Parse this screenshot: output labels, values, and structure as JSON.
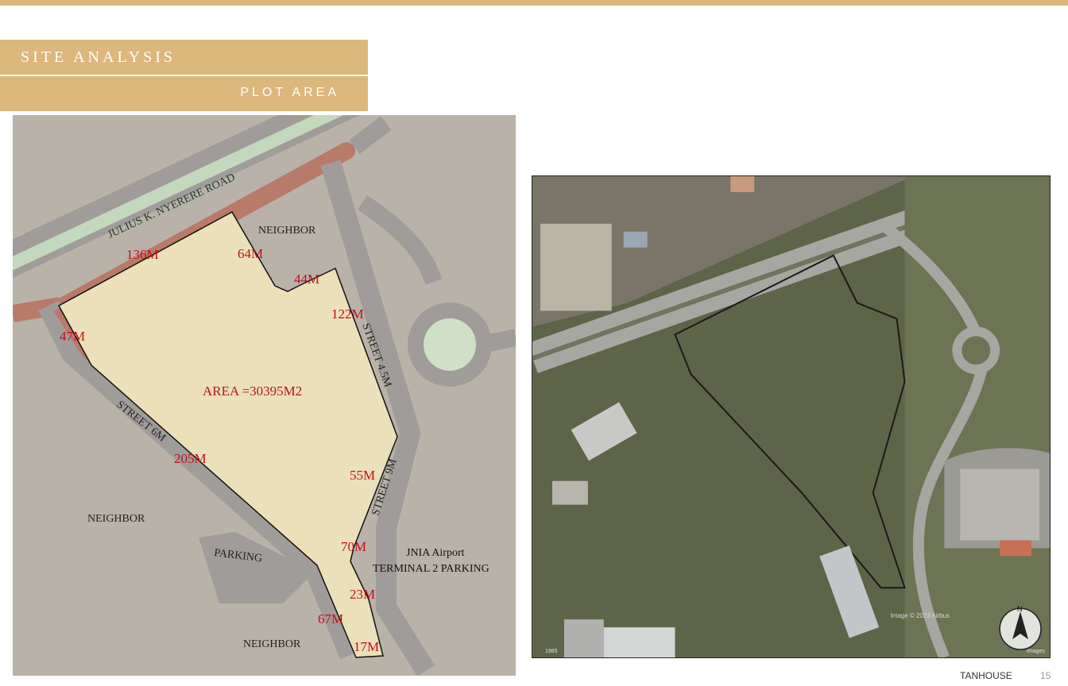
{
  "header": {
    "title": "SITE ANALYSIS",
    "subtitle": "PLOT AREA"
  },
  "plan": {
    "road_label": "JULIUS K. NYERERE ROAD",
    "area_label": "AREA =30395M2",
    "street_labels": [
      "STREET 4.5M",
      "STREET 6M",
      "STREET 9M"
    ],
    "neighbor_label": "NEIGHBOR",
    "parking_label": "PARKING",
    "terminal_label_line1": "JNIA Airport",
    "terminal_label_line2": "TERMINAL 2 PARKING",
    "dimensions": [
      "136M",
      "64M",
      "44M",
      "122M",
      "47M",
      "205M",
      "55M",
      "70M",
      "23M",
      "67M",
      "17M"
    ],
    "colors": {
      "background": "#b9b2a8",
      "road": "#a09c99",
      "buffer": "#b87a69",
      "green_strip": "#c4d8be",
      "plot": "#ebe0b9",
      "roundabout": "#cfe0c6",
      "dimension_text": "#c0101a"
    }
  },
  "aerial": {
    "watermark": "Image © 2023 Airbus",
    "corner_left": "1985",
    "corner_right": "Images",
    "compass_label": "N"
  },
  "footer": {
    "brand": "TANHOUSE",
    "page_number": "15"
  }
}
